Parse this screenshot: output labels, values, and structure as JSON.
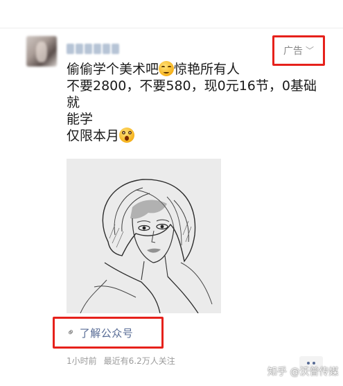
{
  "post": {
    "lines": [
      "偷偷学个美术吧",
      "惊艳所有人",
      "不要2800，不要580，现0元16节，0基础",
      "就",
      "能学",
      "仅限本月"
    ],
    "emojis": [
      "smile-emoji",
      "shock-emoji"
    ]
  },
  "ad": {
    "label": "广告",
    "chevron_icon": "chevron-down-icon"
  },
  "link": {
    "label": "了解公众号",
    "icon": "link-icon"
  },
  "meta": {
    "time": "1小时前",
    "followers": "最近有6.2万人关注"
  },
  "watermark": "知乎 @沃普传媒",
  "colors": {
    "highlight_border": "#e6211b",
    "link_text": "#576b95",
    "meta_text": "#9a9a9a"
  }
}
